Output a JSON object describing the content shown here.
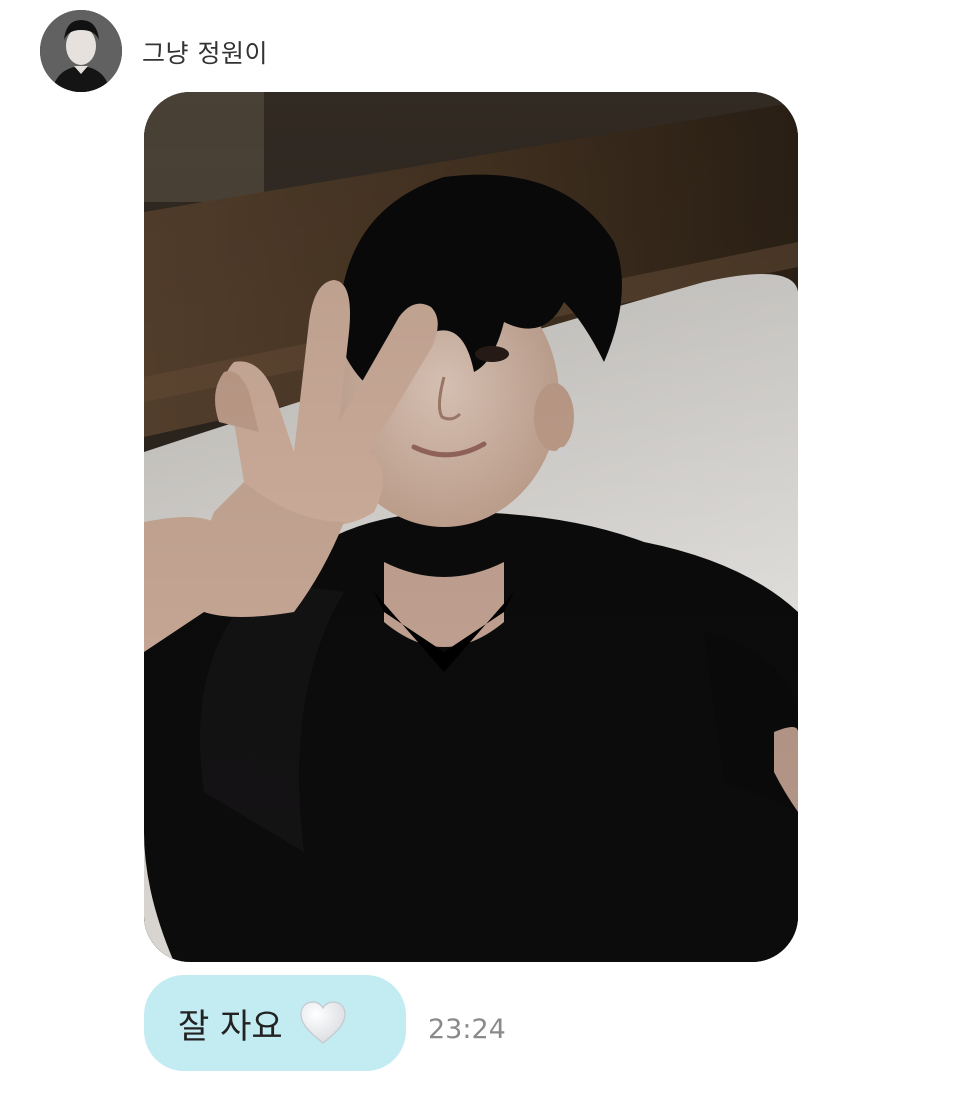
{
  "conversation": {
    "sender_name": "그냥 정원이"
  },
  "messages": [
    {
      "type": "photo"
    },
    {
      "type": "text",
      "text": "잘 자요",
      "emoji": "white-heart-icon",
      "time": "23:24"
    }
  ],
  "colors": {
    "bubble_bg": "#c3ebf2",
    "text": "#222222",
    "timestamp": "#8a8a8a",
    "name": "#333333"
  }
}
